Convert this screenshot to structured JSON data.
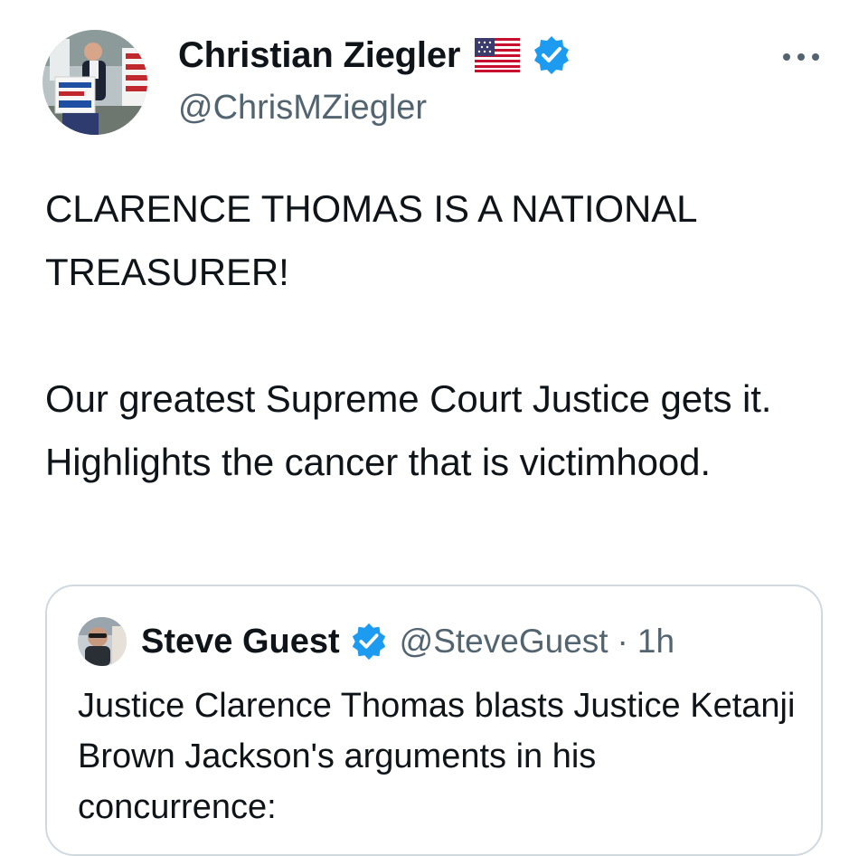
{
  "author": {
    "display_name": "Christian Ziegler",
    "handle": "@ChrisMZiegler",
    "flag_icon": "us-flag-icon",
    "verified_icon": "verified-badge-icon",
    "verified_color": "#1d9bf0",
    "avatar_sign_text": "FLORIDA BLUEPRINT"
  },
  "more_icon": "more-options-icon",
  "tweet": {
    "paragraphs": [
      "CLARENCE THOMAS IS A NATIONAL TREASURER!",
      "Our greatest Supreme Court Justice gets it. Highlights the cancer that is victimhood."
    ]
  },
  "quote": {
    "display_name": "Steve Guest",
    "handle": "@SteveGuest",
    "separator": "·",
    "time": "1h",
    "verified_icon": "verified-badge-icon",
    "text": "Justice Clarence Thomas blasts Justice Ketanji Brown Jackson's arguments in his concurrence:"
  },
  "colors": {
    "text_primary": "#0f1419",
    "text_secondary": "#536471",
    "card_border": "#cfd9de",
    "brand_blue": "#1d9bf0"
  }
}
